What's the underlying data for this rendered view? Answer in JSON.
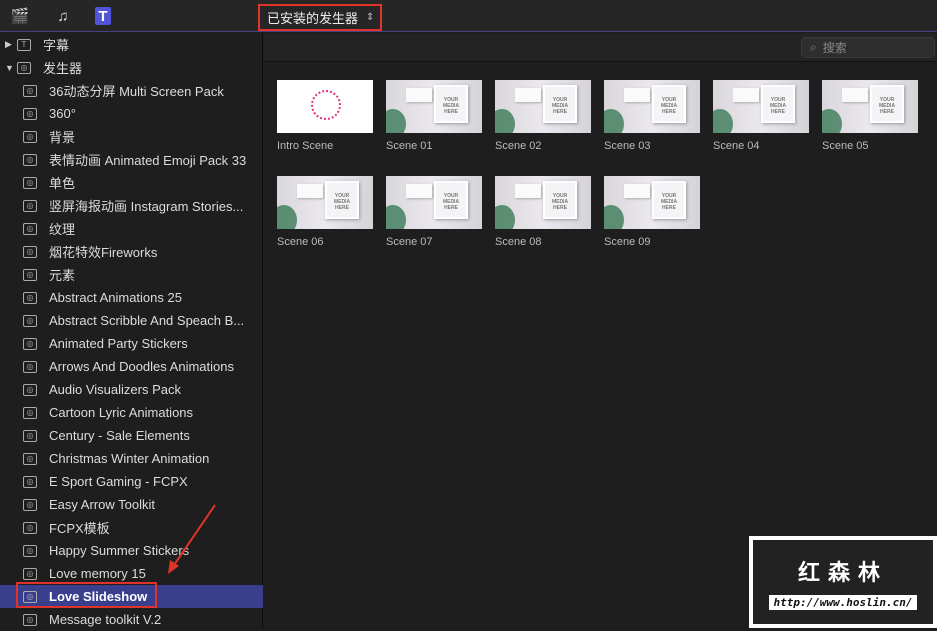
{
  "toolbar": {
    "dropdown_label": "已安装的发生器",
    "dropdown_chevron": "⌃⌄"
  },
  "search": {
    "placeholder": "搜索",
    "icon": "search-icon"
  },
  "sidebar": {
    "groups": [
      {
        "label": "字幕",
        "expanded": false
      },
      {
        "label": "发生器",
        "expanded": true
      }
    ],
    "items": [
      "36动态分屏 Multi Screen Pack",
      "360°",
      "背景",
      "表情动画 Animated Emoji Pack 33",
      "单色",
      "竖屏海报动画 Instagram Stories...",
      "纹理",
      "烟花特效Fireworks",
      "元素",
      "Abstract Animations 25",
      "Abstract Scribble And Speach B...",
      "Animated Party Stickers",
      "Arrows And Doodles Animations",
      "Audio Visualizers Pack",
      "Cartoon Lyric Animations",
      "Century - Sale Elements",
      "Christmas Winter Animation",
      "E Sport Gaming - FCPX",
      "Easy Arrow Toolkit",
      "FCPX模板",
      "Happy Summer Stickers",
      "Love memory 15",
      "Love Slideshow",
      "Message toolkit V.2"
    ],
    "selected_index": 22
  },
  "thumb_placeholder": "YOUR MEDIA HERE",
  "tiles": [
    "Intro Scene",
    "Scene 01",
    "Scene 02",
    "Scene 03",
    "Scene 04",
    "Scene 05",
    "Scene 06",
    "Scene 07",
    "Scene 08",
    "Scene 09"
  ],
  "watermark": {
    "title": "红森林",
    "url": "http://www.hoslin.cn/"
  },
  "colors": {
    "selection": "#3a3f8d",
    "highlight_box": "#e0332a"
  }
}
